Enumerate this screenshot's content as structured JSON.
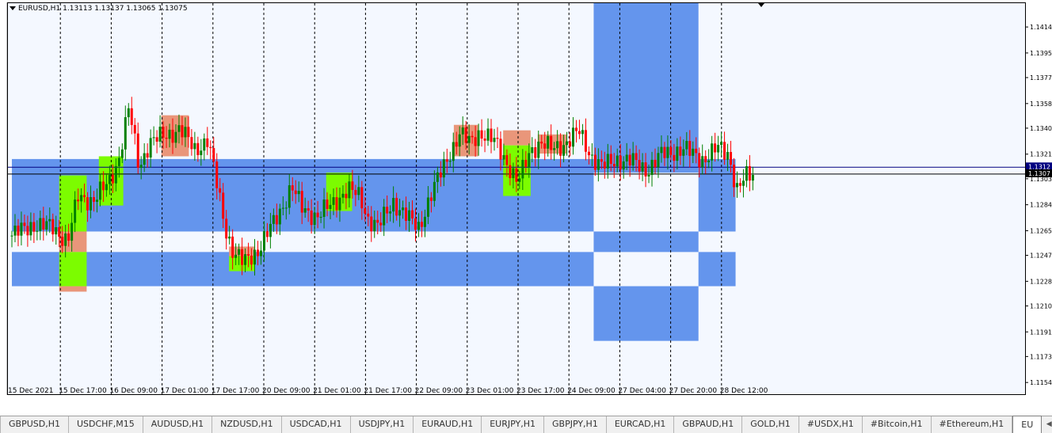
{
  "chart_header": {
    "menu_icon": "triangle-down-icon",
    "symbol": "EURUSD,H1",
    "ohlc": "1.13113 1.13137 1.13065 1.13075"
  },
  "chart_data": {
    "type": "candlestick",
    "symbol": "EURUSD",
    "timeframe": "H1",
    "ylim": [
      1.1146,
      1.1432
    ],
    "y_ticks": [
      "1.1414",
      "1.1395",
      "1.1377",
      "1.1358",
      "1.1340",
      "1.1321",
      "1.1303",
      "1.1284",
      "1.1265",
      "1.1247",
      "1.1228",
      "1.1210",
      "1.1191",
      "1.1173",
      "1.1154"
    ],
    "x_labels": [
      "15 Dec 2021",
      "15 Dec 17:00",
      "16 Dec 09:00",
      "17 Dec 01:00",
      "17 Dec 17:00",
      "20 Dec 09:00",
      "21 Dec 01:00",
      "21 Dec 17:00",
      "22 Dec 09:00",
      "23 Dec 01:00",
      "23 Dec 17:00",
      "24 Dec 09:00",
      "27 Dec 04:00",
      "27 Dec 20:00",
      "28 Dec 12:00"
    ],
    "x_label_pos": [
      0,
      1,
      2,
      3,
      4,
      5,
      6,
      7,
      8,
      9,
      10,
      11,
      12,
      13,
      14
    ],
    "price_lines": [
      {
        "label": "1.1312",
        "value": 1.1312,
        "color": "#000080"
      },
      {
        "label": "1.1307",
        "value": 1.1307,
        "color": "#000000"
      }
    ],
    "zone_color": "#6495ed",
    "supply_color": "#e9967a",
    "demand_color": "#7cfc00",
    "up_color": "#008000",
    "down_color": "#ff0000",
    "zones": [
      {
        "x0": 0.0,
        "x1": 11.44,
        "y0": 1.1318,
        "y1": 1.1265
      },
      {
        "x0": 0.0,
        "x1": 11.44,
        "y0": 1.125,
        "y1": 1.1225
      },
      {
        "x0": 11.44,
        "x1": 13.5,
        "y0": 1.1432,
        "y1": 1.1308
      },
      {
        "x0": 11.44,
        "x1": 13.5,
        "y0": 1.1265,
        "y1": 1.125
      },
      {
        "x0": 11.44,
        "x1": 13.5,
        "y0": 1.1225,
        "y1": 1.1185
      },
      {
        "x0": 13.5,
        "x1": 14.23,
        "y0": 1.1318,
        "y1": 1.1265
      },
      {
        "x0": 13.5,
        "x1": 14.23,
        "y0": 1.125,
        "y1": 1.1225
      }
    ],
    "supply_boxes": [
      {
        "x0": 0.93,
        "x1": 1.47,
        "y0": 1.1265,
        "y1": 1.125
      },
      {
        "x0": 0.93,
        "x1": 1.47,
        "y0": 1.1225,
        "y1": 1.1221
      },
      {
        "x0": 2.94,
        "x1": 3.48,
        "y0": 1.135,
        "y1": 1.132
      },
      {
        "x0": 4.27,
        "x1": 4.78,
        "y0": 1.1254,
        "y1": 1.1247
      },
      {
        "x0": 8.69,
        "x1": 9.17,
        "y0": 1.1343,
        "y1": 1.132
      },
      {
        "x0": 9.66,
        "x1": 10.2,
        "y0": 1.1339,
        "y1": 1.1328
      },
      {
        "x0": 10.34,
        "x1": 10.91,
        "y0": 1.1336,
        "y1": 1.1322
      }
    ],
    "demand_boxes": [
      {
        "x0": 0.93,
        "x1": 1.47,
        "y0": 1.1306,
        "y1": 1.1265
      },
      {
        "x0": 0.93,
        "x1": 1.47,
        "y0": 1.125,
        "y1": 1.1225
      },
      {
        "x0": 1.71,
        "x1": 2.19,
        "y0": 1.132,
        "y1": 1.1284
      },
      {
        "x0": 4.27,
        "x1": 4.78,
        "y0": 1.1247,
        "y1": 1.1236
      },
      {
        "x0": 6.18,
        "x1": 6.69,
        "y0": 1.1308,
        "y1": 1.128
      },
      {
        "x0": 9.66,
        "x1": 10.2,
        "y0": 1.1328,
        "y1": 1.1291
      }
    ],
    "anchors": [
      [
        0.0,
        1.1262
      ],
      [
        0.4,
        1.127
      ],
      [
        0.8,
        1.1268
      ],
      [
        1.1,
        1.1258
      ],
      [
        1.3,
        1.129
      ],
      [
        1.6,
        1.1288
      ],
      [
        1.9,
        1.13
      ],
      [
        2.1,
        1.1318
      ],
      [
        2.3,
        1.1355
      ],
      [
        2.5,
        1.1312
      ],
      [
        2.7,
        1.133
      ],
      [
        3.0,
        1.1335
      ],
      [
        3.3,
        1.134
      ],
      [
        3.6,
        1.1325
      ],
      [
        3.85,
        1.1332
      ],
      [
        4.0,
        1.1305
      ],
      [
        4.2,
        1.1268
      ],
      [
        4.35,
        1.125
      ],
      [
        4.55,
        1.1242
      ],
      [
        4.85,
        1.1252
      ],
      [
        5.1,
        1.1268
      ],
      [
        5.3,
        1.1282
      ],
      [
        5.5,
        1.1298
      ],
      [
        5.7,
        1.1282
      ],
      [
        6.0,
        1.1276
      ],
      [
        6.3,
        1.1285
      ],
      [
        6.6,
        1.1296
      ],
      [
        6.85,
        1.129
      ],
      [
        7.0,
        1.1275
      ],
      [
        7.2,
        1.1268
      ],
      [
        7.5,
        1.1287
      ],
      [
        7.8,
        1.1274
      ],
      [
        8.0,
        1.1268
      ],
      [
        8.2,
        1.1288
      ],
      [
        8.4,
        1.1305
      ],
      [
        8.6,
        1.1322
      ],
      [
        8.8,
        1.1336
      ],
      [
        9.0,
        1.133
      ],
      [
        9.2,
        1.1338
      ],
      [
        9.5,
        1.133
      ],
      [
        9.7,
        1.1318
      ],
      [
        9.95,
        1.13
      ],
      [
        10.2,
        1.1325
      ],
      [
        10.4,
        1.133
      ],
      [
        10.6,
        1.1325
      ],
      [
        10.9,
        1.133
      ],
      [
        11.15,
        1.1338
      ],
      [
        11.4,
        1.132
      ],
      [
        11.6,
        1.1312
      ],
      [
        11.9,
        1.1318
      ],
      [
        12.2,
        1.1316
      ],
      [
        12.5,
        1.131
      ],
      [
        12.8,
        1.1322
      ],
      [
        13.2,
        1.1325
      ],
      [
        13.6,
        1.1318
      ],
      [
        13.9,
        1.1326
      ],
      [
        14.1,
        1.1322
      ],
      [
        14.25,
        1.1295
      ],
      [
        14.45,
        1.1305
      ],
      [
        14.6,
        1.1307
      ]
    ]
  },
  "axis_price_labels": {
    "current_ask": "1.1312",
    "current_bid": "1.1307"
  },
  "tabs": {
    "items": [
      "GBPUSD,H1",
      "USDCHF,M15",
      "AUDUSD,H1",
      "NZDUSD,H1",
      "USDCAD,H1",
      "USDJPY,H1",
      "EURAUD,H1",
      "EURJPY,H1",
      "GBPJPY,H1",
      "EURCAD,H1",
      "GBPAUD,H1",
      "GOLD,H1",
      "#USDX,H1",
      "#Bitcoin,H1",
      "#Ethereum,H1",
      "EU"
    ],
    "active_index": 15,
    "scroll_left_icon": "arrow-left-icon",
    "scroll_right_icon": "arrow-right-icon"
  }
}
